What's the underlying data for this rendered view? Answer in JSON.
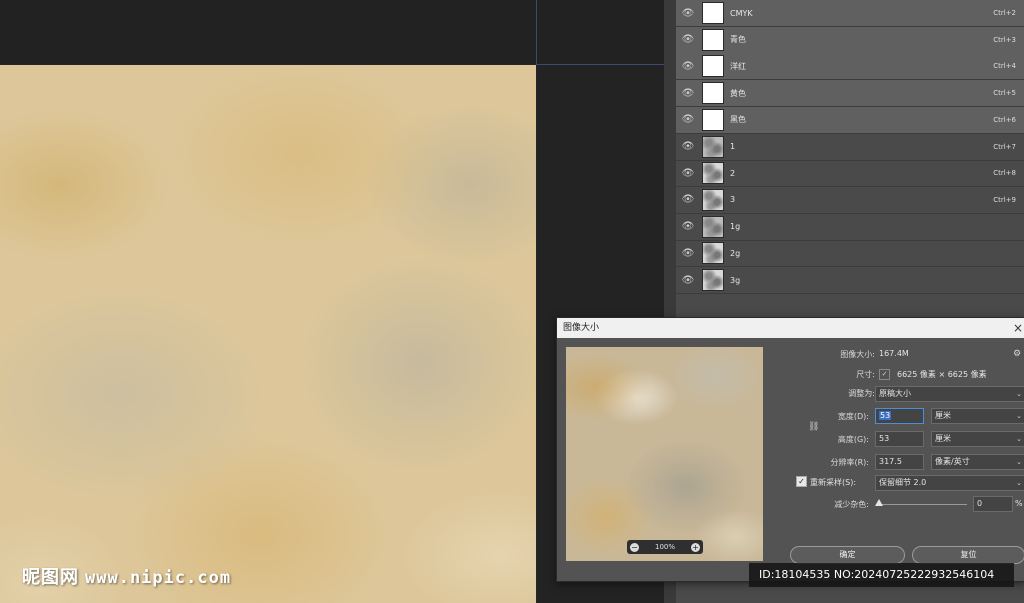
{
  "canvas": {
    "watermark_logo": "昵图网",
    "watermark_site": "www.nipic.com"
  },
  "channels": [
    {
      "name": "CMYK",
      "shortcut": "Ctrl+2",
      "thumb": "white",
      "selected": true
    },
    {
      "name": "青色",
      "shortcut": "Ctrl+3",
      "thumb": "white",
      "selected": true
    },
    {
      "name": "洋红",
      "shortcut": "Ctrl+4",
      "thumb": "white",
      "selected": true
    },
    {
      "name": "黄色",
      "shortcut": "Ctrl+5",
      "thumb": "white",
      "selected": true
    },
    {
      "name": "黑色",
      "shortcut": "Ctrl+6",
      "thumb": "white",
      "selected": true
    },
    {
      "name": "1",
      "shortcut": "Ctrl+7",
      "thumb": "noise",
      "selected": false
    },
    {
      "name": "2",
      "shortcut": "Ctrl+8",
      "thumb": "noise-light",
      "selected": false
    },
    {
      "name": "3",
      "shortcut": "Ctrl+9",
      "thumb": "noise-light",
      "selected": false
    },
    {
      "name": "1g",
      "shortcut": "",
      "thumb": "noise",
      "selected": false
    },
    {
      "name": "2g",
      "shortcut": "",
      "thumb": "noise-light",
      "selected": false
    },
    {
      "name": "3g",
      "shortcut": "",
      "thumb": "noise-light",
      "selected": false
    }
  ],
  "dialog": {
    "title": "图像大小",
    "close": "×",
    "image_size_label": "图像大小:",
    "image_size_value": "167.4M",
    "dimensions_label": "尺寸:",
    "dimensions_value": "6625 像素 × 6625 像素",
    "fit_to_label": "调整为:",
    "fit_to_value": "原稿大小",
    "width_label": "宽度(D):",
    "width_value": "53",
    "width_unit": "厘米",
    "height_label": "高度(G):",
    "height_value": "53",
    "height_unit": "厘米",
    "resolution_label": "分辨率(R):",
    "resolution_value": "317.5",
    "resolution_unit": "像素/英寸",
    "resample_label": "重新采样(S):",
    "resample_value": "保留细节 2.0",
    "noise_label": "减少杂色:",
    "noise_value": "0",
    "noise_unit": "%",
    "zoom_value": "100%",
    "ok_label": "确定",
    "reset_label": "复位"
  },
  "watermark": {
    "id_text": "ID:18104535 NO:20240725222932546104"
  }
}
